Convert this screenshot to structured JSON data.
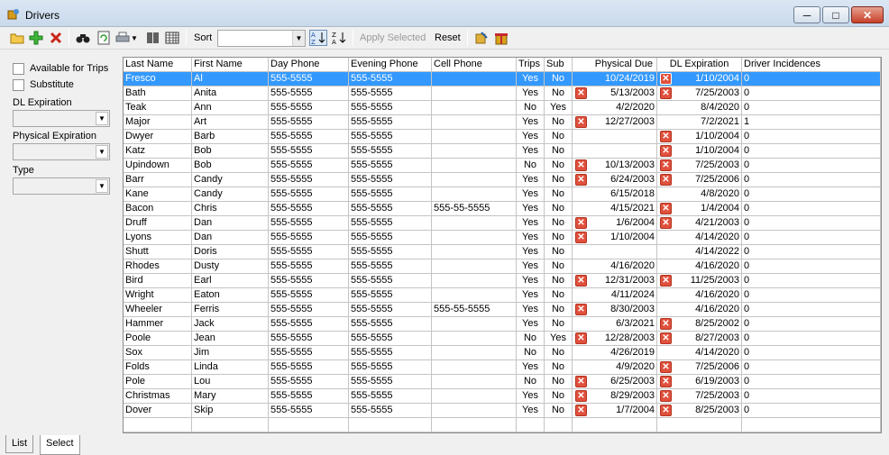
{
  "window": {
    "title": "Drivers"
  },
  "toolbar": {
    "icons": [
      "folder-open-icon",
      "add-icon",
      "delete-icon",
      "binoculars-icon",
      "refresh-icon",
      "print-icon",
      "dropdown-arrow-icon",
      "barcode-icon",
      "grid-icon"
    ],
    "sort_label": "Sort",
    "sort_value": "",
    "sort_asc_label": "A↓Z",
    "sort_desc_label": "Z↓A",
    "apply_label": "Apply Selected",
    "reset_label": "Reset"
  },
  "filters": {
    "available_label": "Available for Trips",
    "substitute_label": "Substitute",
    "dl_label": "DL Expiration",
    "physical_label": "Physical Expiration",
    "type_label": "Type"
  },
  "grid": {
    "columns": [
      "Last Name",
      "First Name",
      "Day Phone",
      "Evening Phone",
      "Cell Phone",
      "Trips",
      "Sub",
      "Physical Due",
      "DL Expiration",
      "Driver Incidences"
    ],
    "rows": [
      {
        "last": "Fresco",
        "first": "Al",
        "day": "555-5555",
        "eve": "555-5555",
        "cell": "",
        "trips": "Yes",
        "sub": "No",
        "phys": "10/24/2019",
        "phys_x": false,
        "dl": "1/10/2004",
        "dl_x": true,
        "inc": "0",
        "selected": true
      },
      {
        "last": "Bath",
        "first": "Anita",
        "day": "555-5555",
        "eve": "555-5555",
        "cell": "",
        "trips": "Yes",
        "sub": "No",
        "phys": "5/13/2003",
        "phys_x": true,
        "dl": "7/25/2003",
        "dl_x": true,
        "inc": "0"
      },
      {
        "last": "Teak",
        "first": "Ann",
        "day": "555-5555",
        "eve": "555-5555",
        "cell": "",
        "trips": "No",
        "sub": "Yes",
        "phys": "4/2/2020",
        "phys_x": false,
        "dl": "8/4/2020",
        "dl_x": false,
        "inc": "0"
      },
      {
        "last": "Major",
        "first": "Art",
        "day": "555-5555",
        "eve": "555-5555",
        "cell": "",
        "trips": "Yes",
        "sub": "No",
        "phys": "12/27/2003",
        "phys_x": true,
        "dl": "7/2/2021",
        "dl_x": false,
        "inc": "1"
      },
      {
        "last": "Dwyer",
        "first": "Barb",
        "day": "555-5555",
        "eve": "555-5555",
        "cell": "",
        "trips": "Yes",
        "sub": "No",
        "phys": "",
        "phys_x": false,
        "dl": "1/10/2004",
        "dl_x": true,
        "inc": "0"
      },
      {
        "last": "Katz",
        "first": "Bob",
        "day": "555-5555",
        "eve": "555-5555",
        "cell": "",
        "trips": "Yes",
        "sub": "No",
        "phys": "",
        "phys_x": false,
        "dl": "1/10/2004",
        "dl_x": true,
        "inc": "0"
      },
      {
        "last": "Upindown",
        "first": "Bob",
        "day": "555-5555",
        "eve": "555-5555",
        "cell": "",
        "trips": "No",
        "sub": "No",
        "phys": "10/13/2003",
        "phys_x": true,
        "dl": "7/25/2003",
        "dl_x": true,
        "inc": "0"
      },
      {
        "last": "Barr",
        "first": "Candy",
        "day": "555-5555",
        "eve": "555-5555",
        "cell": "",
        "trips": "Yes",
        "sub": "No",
        "phys": "6/24/2003",
        "phys_x": true,
        "dl": "7/25/2006",
        "dl_x": true,
        "inc": "0"
      },
      {
        "last": "Kane",
        "first": "Candy",
        "day": "555-5555",
        "eve": "555-5555",
        "cell": "",
        "trips": "Yes",
        "sub": "No",
        "phys": "6/15/2018",
        "phys_x": false,
        "dl": "4/8/2020",
        "dl_x": false,
        "inc": "0"
      },
      {
        "last": "Bacon",
        "first": "Chris",
        "day": "555-5555",
        "eve": "555-5555",
        "cell": "555-55-5555",
        "trips": "Yes",
        "sub": "No",
        "phys": "4/15/2021",
        "phys_x": false,
        "dl": "1/4/2004",
        "dl_x": true,
        "inc": "0"
      },
      {
        "last": "Druff",
        "first": "Dan",
        "day": "555-5555",
        "eve": "555-5555",
        "cell": "",
        "trips": "Yes",
        "sub": "No",
        "phys": "1/6/2004",
        "phys_x": true,
        "dl": "4/21/2003",
        "dl_x": true,
        "inc": "0"
      },
      {
        "last": "Lyons",
        "first": "Dan",
        "day": "555-5555",
        "eve": "555-5555",
        "cell": "",
        "trips": "Yes",
        "sub": "No",
        "phys": "1/10/2004",
        "phys_x": true,
        "dl": "4/14/2020",
        "dl_x": false,
        "inc": "0"
      },
      {
        "last": "Shutt",
        "first": "Doris",
        "day": "555-5555",
        "eve": "555-5555",
        "cell": "",
        "trips": "Yes",
        "sub": "No",
        "phys": "",
        "phys_x": false,
        "dl": "4/14/2022",
        "dl_x": false,
        "inc": "0"
      },
      {
        "last": "Rhodes",
        "first": "Dusty",
        "day": "555-5555",
        "eve": "555-5555",
        "cell": "",
        "trips": "Yes",
        "sub": "No",
        "phys": "4/16/2020",
        "phys_x": false,
        "dl": "4/16/2020",
        "dl_x": false,
        "inc": "0"
      },
      {
        "last": "Bird",
        "first": "Earl",
        "day": "555-5555",
        "eve": "555-5555",
        "cell": "",
        "trips": "Yes",
        "sub": "No",
        "phys": "12/31/2003",
        "phys_x": true,
        "dl": "11/25/2003",
        "dl_x": true,
        "inc": "0"
      },
      {
        "last": "Wright",
        "first": "Eaton",
        "day": "555-5555",
        "eve": "555-5555",
        "cell": "",
        "trips": "Yes",
        "sub": "No",
        "phys": "4/11/2024",
        "phys_x": false,
        "dl": "4/16/2020",
        "dl_x": false,
        "inc": "0"
      },
      {
        "last": "Wheeler",
        "first": "Ferris",
        "day": "555-5555",
        "eve": "555-5555",
        "cell": "555-55-5555",
        "trips": "Yes",
        "sub": "No",
        "phys": "8/30/2003",
        "phys_x": true,
        "dl": "4/16/2020",
        "dl_x": false,
        "inc": "0"
      },
      {
        "last": "Hammer",
        "first": "Jack",
        "day": "555-5555",
        "eve": "555-5555",
        "cell": "",
        "trips": "Yes",
        "sub": "No",
        "phys": "6/3/2021",
        "phys_x": false,
        "dl": "8/25/2002",
        "dl_x": true,
        "inc": "0"
      },
      {
        "last": "Poole",
        "first": "Jean",
        "day": "555-5555",
        "eve": "555-5555",
        "cell": "",
        "trips": "No",
        "sub": "Yes",
        "phys": "12/28/2003",
        "phys_x": true,
        "dl": "8/27/2003",
        "dl_x": true,
        "inc": "0"
      },
      {
        "last": "Sox",
        "first": "Jim",
        "day": "555-5555",
        "eve": "555-5555",
        "cell": "",
        "trips": "No",
        "sub": "No",
        "phys": "4/26/2019",
        "phys_x": false,
        "dl": "4/14/2020",
        "dl_x": false,
        "inc": "0"
      },
      {
        "last": "Folds",
        "first": "Linda",
        "day": "555-5555",
        "eve": "555-5555",
        "cell": "",
        "trips": "Yes",
        "sub": "No",
        "phys": "4/9/2020",
        "phys_x": false,
        "dl": "7/25/2006",
        "dl_x": true,
        "inc": "0"
      },
      {
        "last": "Pole",
        "first": "Lou",
        "day": "555-5555",
        "eve": "555-5555",
        "cell": "",
        "trips": "No",
        "sub": "No",
        "phys": "6/25/2003",
        "phys_x": true,
        "dl": "6/19/2003",
        "dl_x": true,
        "inc": "0"
      },
      {
        "last": "Christmas",
        "first": "Mary",
        "day": "555-5555",
        "eve": "555-5555",
        "cell": "",
        "trips": "Yes",
        "sub": "No",
        "phys": "8/29/2003",
        "phys_x": true,
        "dl": "7/25/2003",
        "dl_x": true,
        "inc": "0"
      },
      {
        "last": "Dover",
        "first": "Skip",
        "day": "555-5555",
        "eve": "555-5555",
        "cell": "",
        "trips": "Yes",
        "sub": "No",
        "phys": "1/7/2004",
        "phys_x": true,
        "dl": "8/25/2003",
        "dl_x": true,
        "inc": "0"
      },
      {
        "last": "",
        "first": "",
        "day": "",
        "eve": "",
        "cell": "",
        "trips": "",
        "sub": "",
        "phys": "",
        "phys_x": false,
        "dl": "",
        "dl_x": false,
        "inc": ""
      }
    ]
  },
  "tabs": [
    {
      "label": "List",
      "active": false
    },
    {
      "label": "Select",
      "active": true
    }
  ],
  "colors": {
    "selection": "#3399ff",
    "expired_icon": "#e0513d"
  }
}
